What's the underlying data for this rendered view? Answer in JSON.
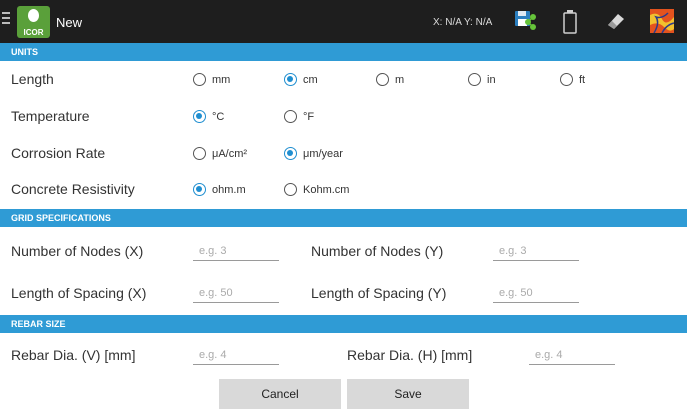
{
  "appbar": {
    "title": "New",
    "logo_text": "ICOR",
    "coords": "X: N/A Y: N/A",
    "icons": [
      "menu-icon",
      "save-share-icon",
      "battery-icon",
      "eraser-icon",
      "map-layer-icon"
    ]
  },
  "units": {
    "header": "UNITS",
    "length": {
      "label": "Length",
      "options": [
        "mm",
        "cm",
        "m",
        "in",
        "ft"
      ],
      "selected": "cm"
    },
    "temperature": {
      "label": "Temperature",
      "options": [
        "°C",
        "°F"
      ],
      "selected": "°C"
    },
    "corrosion_rate": {
      "label": "Corrosion Rate",
      "options": [
        "μA/cm²",
        "μm/year"
      ],
      "selected": "μm/year"
    },
    "resistivity": {
      "label": "Concrete Resistivity",
      "options": [
        "ohm.m",
        "Kohm.cm"
      ],
      "selected": "ohm.m"
    }
  },
  "grid": {
    "header": "GRID SPECIFICATIONS",
    "nodes_x": {
      "label": "Number of Nodes (X)",
      "placeholder": "e.g. 3",
      "value": ""
    },
    "nodes_y": {
      "label": "Number of Nodes (Y)",
      "placeholder": "e.g. 3",
      "value": ""
    },
    "spacing_x": {
      "label": "Length of Spacing (X)",
      "placeholder": "e.g. 50",
      "value": ""
    },
    "spacing_y": {
      "label": "Length of Spacing (Y)",
      "placeholder": "e.g. 50",
      "value": ""
    }
  },
  "rebar": {
    "header": "REBAR SIZE",
    "dia_v": {
      "label": "Rebar Dia. (V) [mm]",
      "placeholder": "e.g. 4",
      "value": ""
    },
    "dia_h": {
      "label": "Rebar Dia. (H) [mm]",
      "placeholder": "e.g. 4",
      "value": ""
    }
  },
  "actions": {
    "cancel": "Cancel",
    "save": "Save"
  },
  "colors": {
    "accent": "#2f9bd5",
    "radio_checked": "#1f8ed0",
    "appbar": "#1e1e1e",
    "logo": "#5aa03a"
  }
}
